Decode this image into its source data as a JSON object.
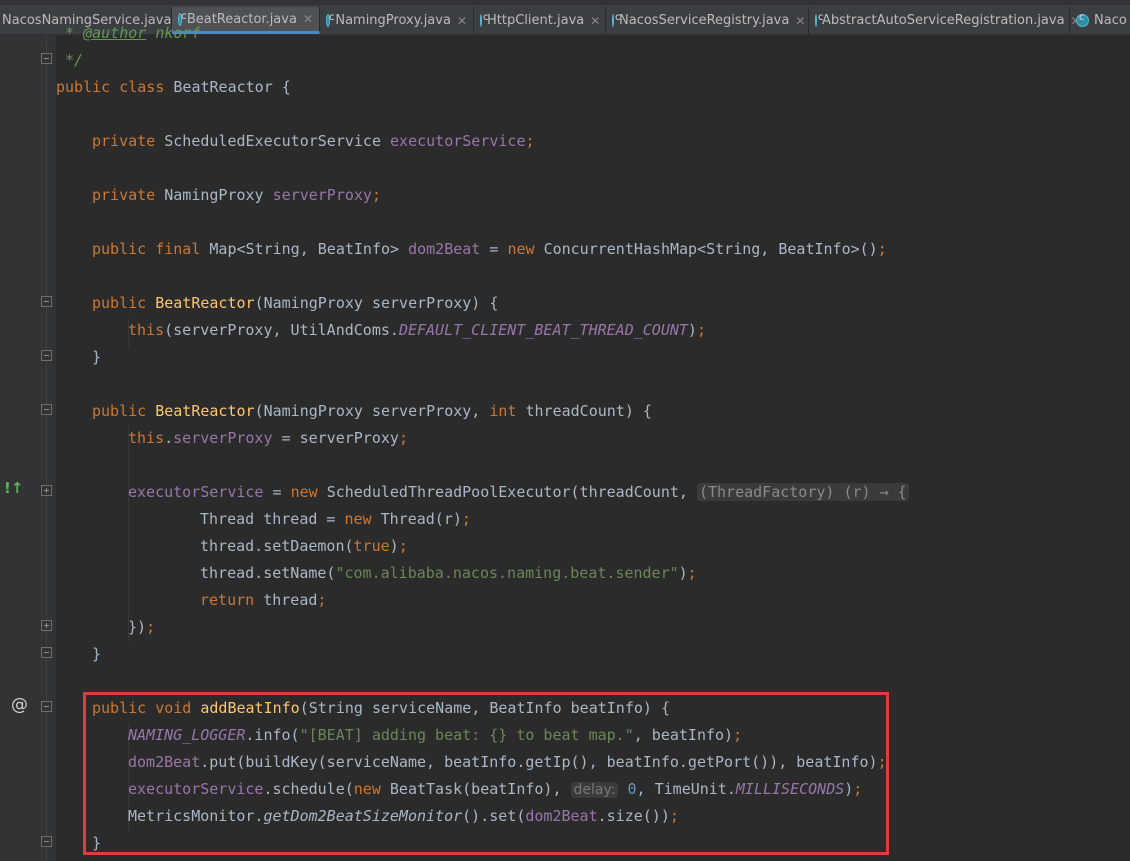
{
  "tabs": [
    {
      "label": "NacosNamingService.java",
      "active": false
    },
    {
      "label": "BeatReactor.java",
      "active": true
    },
    {
      "label": "NamingProxy.java",
      "active": false
    },
    {
      "label": "HttpClient.java",
      "active": false
    },
    {
      "label": "NacosServiceRegistry.java",
      "active": false
    },
    {
      "label": "AbstractAutoServiceRegistration.java",
      "active": false
    },
    {
      "label": "Naco",
      "active": false
    }
  ],
  "gutter": {
    "override_marker": "!↑",
    "at_marker": "@"
  },
  "code": {
    "l0": {
      "t1": " * ",
      "t2": "@author",
      "t3": " nkorf"
    },
    "l1": {
      "t1": " */"
    },
    "l2": {
      "t1": "public class ",
      "t2": "BeatReactor {"
    },
    "l3": {
      "t1": "private ",
      "t2": "ScheduledExecutorService ",
      "t3": "executorService",
      "t4": ";"
    },
    "l4": {
      "t1": "private ",
      "t2": "NamingProxy ",
      "t3": "serverProxy",
      "t4": ";"
    },
    "l5": {
      "t1": "public final ",
      "t2": "Map<String, BeatInfo> ",
      "t3": "dom2Beat",
      "t4": " = ",
      "t5": "new ",
      "t6": "ConcurrentHashMap<String, BeatInfo>()",
      "t7": ";"
    },
    "l6": {
      "t1": "public ",
      "t2": "BeatReactor",
      "t3": "(NamingProxy serverProxy) {"
    },
    "l7": {
      "t1": "this",
      "t2": "(serverProxy, UtilAndComs.",
      "t3": "DEFAULT_CLIENT_BEAT_THREAD_COUNT",
      "t4": ")",
      "t5": ";"
    },
    "l8": {
      "t1": "}"
    },
    "l9": {
      "t1": "public ",
      "t2": "BeatReactor",
      "t3": "(NamingProxy serverProxy, ",
      "t4": "int ",
      "t5": "threadCount) {"
    },
    "l10": {
      "t1": "this",
      "t2": ".",
      "t3": "serverProxy",
      "t4": " = serverProxy",
      "t5": ";"
    },
    "l11": {
      "t1": "executorService",
      "t2": " = ",
      "t3": "new ",
      "t4": "ScheduledThreadPoolExecutor(threadCount, ",
      "t5": "(ThreadFactory) (r) → {"
    },
    "l12": {
      "t1": "Thread thread = ",
      "t2": "new ",
      "t3": "Thread(r)",
      "t4": ";"
    },
    "l13": {
      "t1": "thread.setDaemon(",
      "t2": "true",
      "t3": ")",
      "t4": ";"
    },
    "l14": {
      "t1": "thread.setName(",
      "t2": "\"com.alibaba.nacos.naming.beat.sender\"",
      "t3": ")",
      "t4": ";"
    },
    "l15": {
      "t1": "return ",
      "t2": "thread",
      "t3": ";"
    },
    "l16": {
      "t1": "})",
      "t2": ";"
    },
    "l17": {
      "t1": "}"
    },
    "l18": {
      "t1": "public void ",
      "t2": "addBeatInfo",
      "t3": "(String serviceName, BeatInfo beatInfo) {"
    },
    "l19": {
      "t1": "NAMING_LOGGER",
      "t2": ".info(",
      "t3": "\"[BEAT] adding beat: {} to beat map.\"",
      "t4": ", beatInfo)",
      "t5": ";"
    },
    "l20": {
      "t1": "dom2Beat",
      "t2": ".put(buildKey(serviceName, beatInfo.getIp(), beatInfo.getPort()), beatInfo)",
      "t3": ";"
    },
    "l21": {
      "t1": "executorService",
      "t2": ".schedule(",
      "t3": "new ",
      "t4": "BeatTask(beatInfo), ",
      "t5": "delay:",
      "t6": " 0",
      "t7": ", TimeUnit.",
      "t8": "MILLISECONDS",
      "t9": ")",
      "t10": ";"
    },
    "l22": {
      "t1": "MetricsMonitor.",
      "t2": "getDom2BeatSizeMonitor",
      "t3": "().set(",
      "t4": "dom2Beat",
      "t5": ".size())",
      "t6": ";"
    },
    "l23": {
      "t1": "}"
    }
  },
  "colors": {
    "background": "#2b2b2b",
    "keyword": "#cc7832",
    "field": "#9876aa",
    "method_decl": "#ffc66d",
    "string": "#6a8759",
    "number": "#6897bb",
    "highlight_box": "#e03c3c"
  }
}
